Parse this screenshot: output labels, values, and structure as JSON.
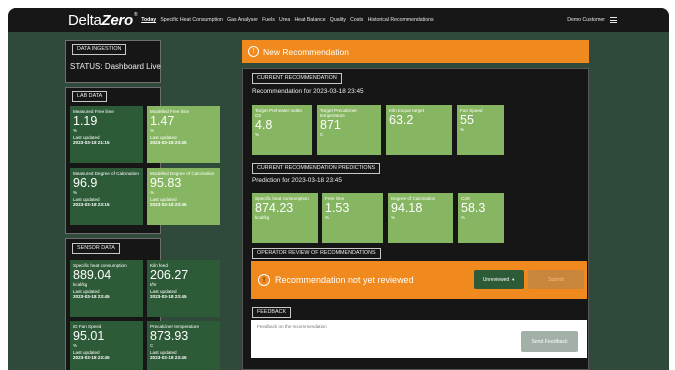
{
  "app": {
    "logo_main": "Delta",
    "logo_bold": "Zero",
    "logo_reg": "®",
    "customer": "Demo Customer"
  },
  "nav": [
    {
      "label": "Today",
      "active": true
    },
    {
      "label": "Specific Heat Consumption"
    },
    {
      "label": "Gas Analyser"
    },
    {
      "label": "Fuels"
    },
    {
      "label": "Urea"
    },
    {
      "label": "Heat Balance"
    },
    {
      "label": "Quality"
    },
    {
      "label": "Costs"
    },
    {
      "label": "Historical Recommendations"
    }
  ],
  "ingestion": {
    "tag": "DATA INGESTION",
    "status": "STATUS: Dashboard Live"
  },
  "lab": {
    "tag": "LAB DATA",
    "cards": [
      {
        "label": "Measured Free lime",
        "value": "1.19",
        "unit": "%",
        "updated_label": "Last updated",
        "updated": "2023-03-18 21:15"
      },
      {
        "label": "Modelled Free lime",
        "value": "1.47",
        "unit": "%",
        "updated_label": "Last updated",
        "updated": "2023-03-18 23:45"
      },
      {
        "label": "Measured Degree of Calcination",
        "value": "96.9",
        "unit": "%",
        "updated_label": "Last updated",
        "updated": "2023-03-18 23:15"
      },
      {
        "label": "Modelled Degree of Calcination",
        "value": "95.83",
        "unit": "%",
        "updated_label": "Last updated",
        "updated": "2023-03-18 23:45"
      }
    ]
  },
  "sensor": {
    "tag": "SENSOR DATA",
    "cards": [
      {
        "label": "Specific heat consumption",
        "value": "889.04",
        "unit": "kcal/kg",
        "updated_label": "Last updated",
        "updated": "2023-03-18 23:45"
      },
      {
        "label": "Kiln feed",
        "value": "206.27",
        "unit": "t/hr",
        "updated_label": "Last updated",
        "updated": "2023-03-18 23:45"
      },
      {
        "label": "ID Fan Speed",
        "value": "95.01",
        "unit": "%",
        "updated_label": "Last updated",
        "updated": "2023-03-18 23:45"
      },
      {
        "label": "Precalciner temperature",
        "value": "873.93",
        "unit": "C",
        "updated_label": "Last updated",
        "updated": "2023-03-18 23:45"
      }
    ]
  },
  "banner": {
    "icon": "!",
    "text": "New Recommendation"
  },
  "current": {
    "tag": "CURRENT RECOMMENDATION",
    "subtitle": "Recommendation for 2023-03-18 23:45",
    "cards": [
      {
        "label": "Target Preheater outlet O2",
        "value": "4.8",
        "unit": "%"
      },
      {
        "label": "Target Precalciner temperature",
        "value": "871",
        "unit": "C"
      },
      {
        "label": "Kiln torque target",
        "value": "63.2",
        "unit": ""
      },
      {
        "label": "Fan Speed",
        "value": "55",
        "unit": "%"
      }
    ]
  },
  "predictions": {
    "tag": "CURRENT RECOMMENDATION PREDICTIONS",
    "subtitle": "Prediction for 2023-03-18 23:45",
    "cards": [
      {
        "label": "Specific heat consumption",
        "value": "874.23",
        "unit": "kcal/kg"
      },
      {
        "label": "Free lime",
        "value": "1.53",
        "unit": "%"
      },
      {
        "label": "Degree of Calcination",
        "value": "94.18",
        "unit": "%"
      },
      {
        "label": "C3S",
        "value": "58.3",
        "unit": "%"
      }
    ]
  },
  "review": {
    "tag": "OPERATOR REVIEW OF RECOMMENDATIONS",
    "icon": "!",
    "message": "Recommendation not yet reviewed",
    "select_value": "Unreviewed",
    "submit_label": "Submit"
  },
  "feedback": {
    "tag": "FEEDBACK",
    "placeholder": "Feedback on the recommendation",
    "send_label": "Send Feedback"
  },
  "colors": {
    "background": "#2f4a3a",
    "topbar": "#171717",
    "panel": "#161616",
    "card_dark": "#2d5a37",
    "card_light": "#86b661",
    "accent_orange": "#f08a1e"
  },
  "icons": {
    "menu": "hamburger-menu-icon",
    "alert": "exclamation-circle-icon",
    "dropdown": "caret-down-icon"
  }
}
